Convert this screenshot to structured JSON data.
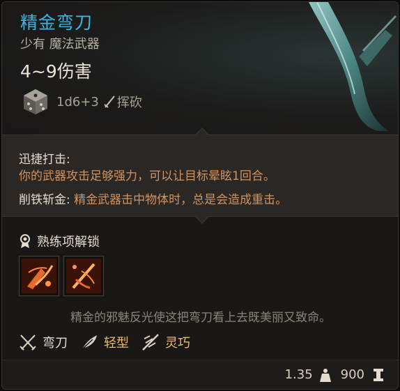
{
  "item": {
    "name": "精金弯刀",
    "rarity_type": "少有 魔法武器",
    "damage": "4~9伤害",
    "dice": "1d6+3",
    "damage_type": "挥砍"
  },
  "passives": [
    {
      "name": "迅捷打击:",
      "desc": "你的武器攻击足够强力，可以让目标晕眩1回合。"
    },
    {
      "name": "削铁斩金:",
      "desc": " 精金武器击中物体时，总是会造成重击。"
    }
  ],
  "proficiency": {
    "title": "熟练项解锁",
    "skills": [
      "skill-slash-icon",
      "skill-flourish-icon"
    ]
  },
  "flavor": "精金的邪魅反光使这把弯刀看上去既美丽又致命。",
  "properties": [
    {
      "label": "弯刀",
      "icon": "crossed-swords-icon"
    },
    {
      "label": "轻型",
      "icon": "feather-icon"
    },
    {
      "label": "灵巧",
      "icon": "finesse-icon"
    }
  ],
  "footer": {
    "weight": "1.35",
    "value": "900"
  },
  "colors": {
    "title": "#3cb4e6",
    "passive_desc": "#d1935f",
    "property_accent": "#e9b96e"
  }
}
